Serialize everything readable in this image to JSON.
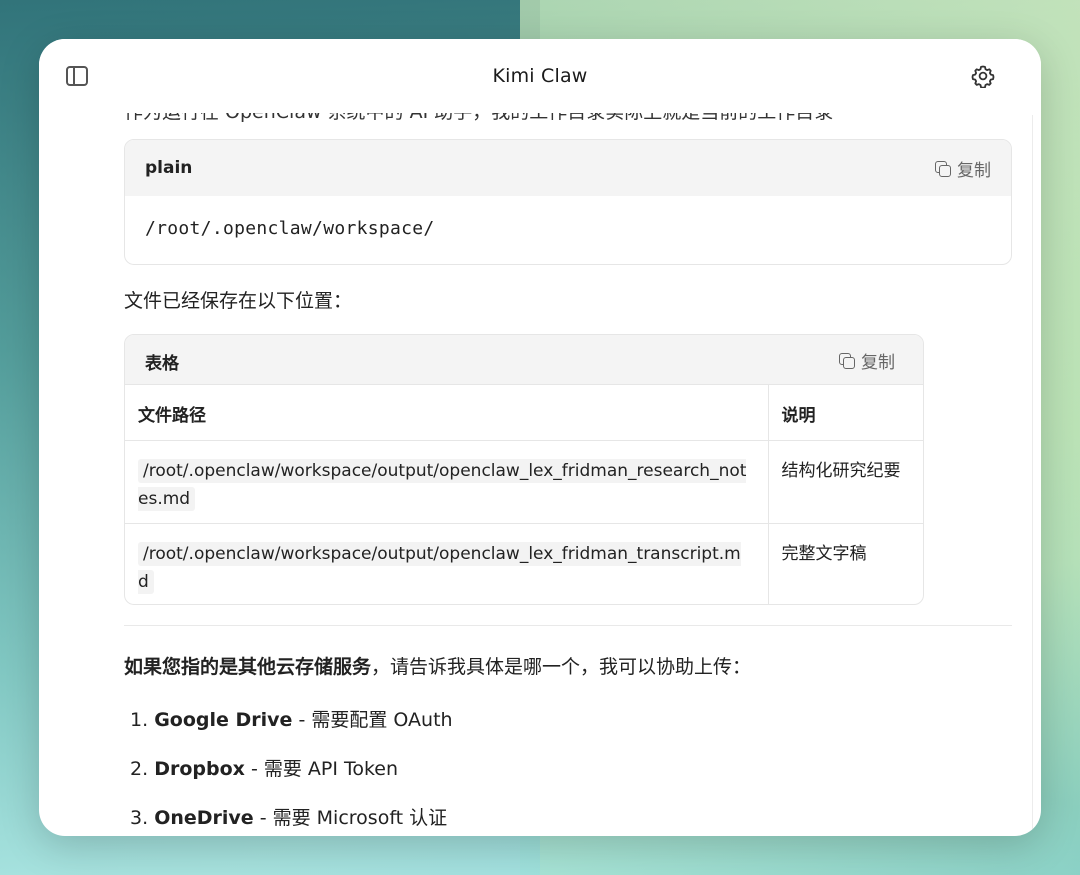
{
  "window": {
    "title": "Kimi Claw"
  },
  "partial_line": "作为运行在 OpenClaw 系统中的 AI 助手，我的工作目录实际上就是当前的工作目录",
  "code_block": {
    "lang": "plain",
    "copy_label": "复制",
    "code": "/root/.openclaw/workspace/"
  },
  "saved_text": "文件已经保存在以下位置：",
  "table": {
    "label": "表格",
    "copy_label": "复制",
    "headers": [
      "文件路径",
      "说明"
    ],
    "rows": [
      {
        "path": "/root/.openclaw/workspace/output/openclaw_lex_fridman_research_notes.md",
        "desc": "结构化研究纪要"
      },
      {
        "path": "/root/.openclaw/workspace/output/openclaw_lex_fridman_transcript.md",
        "desc": "完整文字稿"
      }
    ]
  },
  "cloud_note": {
    "bold": "如果您指的是其他云存储服务",
    "rest": "，请告诉我具体是哪一个，我可以协助上传："
  },
  "options": [
    {
      "num": "1.",
      "name": "Google Drive",
      "desc": " - 需要配置 OAuth"
    },
    {
      "num": "2.",
      "name": "Dropbox",
      "desc": " - 需要 API Token"
    },
    {
      "num": "3.",
      "name": "OneDrive",
      "desc": " - 需要 Microsoft 认证"
    }
  ]
}
